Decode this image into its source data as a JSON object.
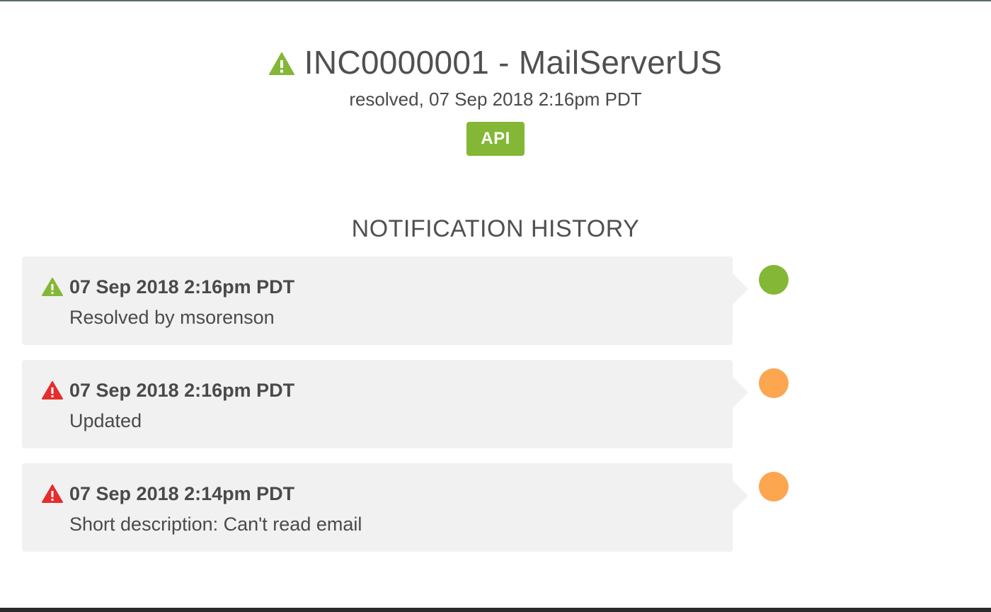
{
  "incident": {
    "title": "INC0000001 - MailServerUS",
    "title_icon": "warning-triangle-icon",
    "status_line": "resolved, 07 Sep 2018 2:16pm PDT",
    "source_badge": "API",
    "status_color": "#84b735"
  },
  "history": {
    "heading": "NOTIFICATION HISTORY",
    "entries": [
      {
        "time": "07 Sep 2018 2:16pm PDT",
        "description": "Resolved by msorenson",
        "icon": "warning-triangle-icon",
        "icon_color": "#84b735",
        "dot_color": "#84b735"
      },
      {
        "time": "07 Sep 2018 2:16pm PDT",
        "description": "Updated",
        "icon": "warning-triangle-icon",
        "icon_color": "#e52d2d",
        "dot_color": "#fca650"
      },
      {
        "time": "07 Sep 2018 2:14pm PDT",
        "description": "Short description: Can't read email",
        "icon": "warning-triangle-icon",
        "icon_color": "#e52d2d",
        "dot_color": "#fca650"
      }
    ]
  }
}
